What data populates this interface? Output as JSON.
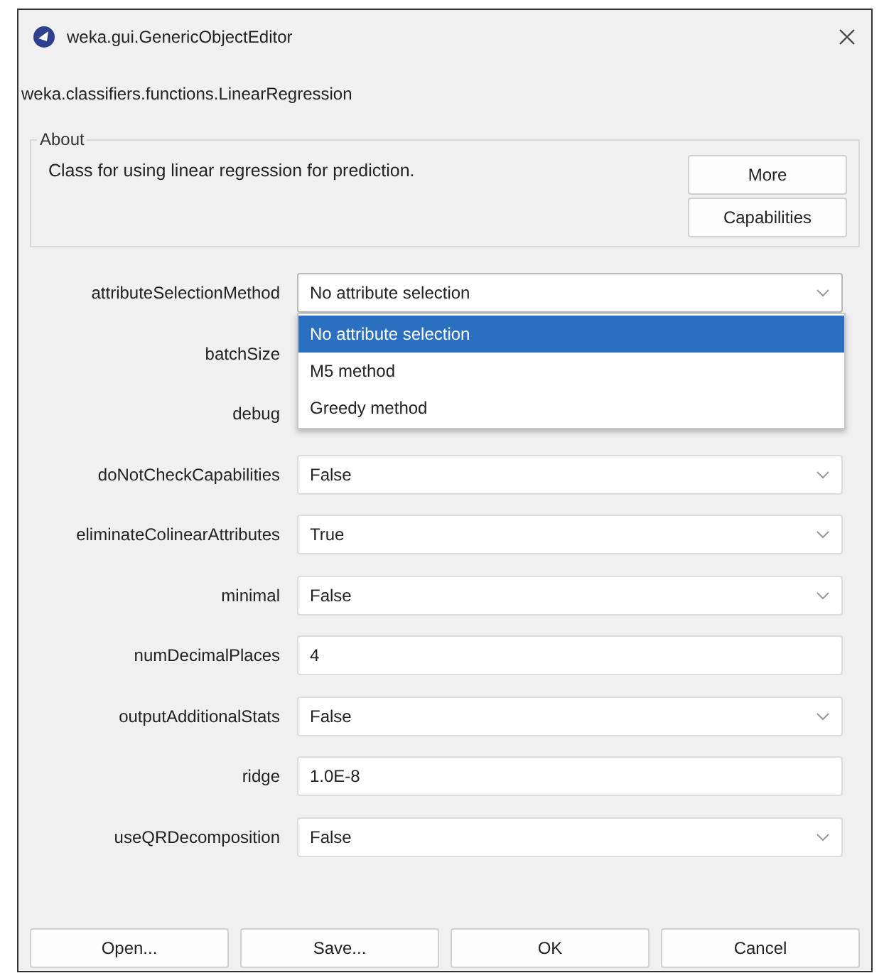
{
  "window": {
    "title": "weka.gui.GenericObjectEditor"
  },
  "class_name": "weka.classifiers.functions.LinearRegression",
  "about": {
    "legend": "About",
    "text": "Class for using linear regression for prediction.",
    "buttons": [
      "More",
      "Capabilities"
    ]
  },
  "properties": [
    {
      "label": "attributeSelectionMethod",
      "kind": "dropdown",
      "value": "No attribute selection",
      "expanded": true,
      "options": [
        {
          "label": "No attribute selection",
          "selected": true
        },
        {
          "label": "M5 method",
          "selected": false
        },
        {
          "label": "Greedy method",
          "selected": false
        }
      ]
    },
    {
      "label": "batchSize"
    },
    {
      "label": "debug"
    },
    {
      "label": "doNotCheckCapabilities",
      "kind": "dropdown",
      "value": "False",
      "expanded": false
    },
    {
      "label": "eliminateColinearAttributes",
      "kind": "dropdown",
      "value": "True",
      "expanded": false
    },
    {
      "label": "minimal",
      "kind": "dropdown",
      "value": "False",
      "expanded": false
    },
    {
      "label": "numDecimalPlaces",
      "kind": "text",
      "value": "4"
    },
    {
      "label": "outputAdditionalStats",
      "kind": "dropdown",
      "value": "False",
      "expanded": false
    },
    {
      "label": "ridge",
      "kind": "text",
      "value": "1.0E-8"
    },
    {
      "label": "useQRDecomposition",
      "kind": "dropdown",
      "value": "False",
      "expanded": false
    }
  ],
  "buttons": [
    "Open...",
    "Save...",
    "OK",
    "Cancel"
  ]
}
